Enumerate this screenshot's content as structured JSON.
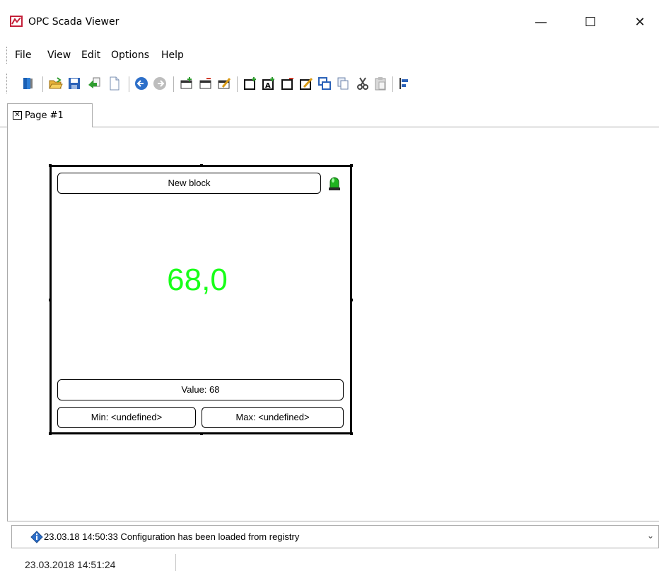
{
  "window": {
    "title": "OPC Scada Viewer",
    "minimize_glyph": "—",
    "maximize_glyph": "☐",
    "close_glyph": "✕"
  },
  "menu": {
    "items": [
      "File",
      "View",
      "Edit",
      "Options",
      "Help"
    ]
  },
  "toolbar": {
    "buttons": [
      "open-door-icon",
      "open-folder-icon",
      "save-icon",
      "import-icon",
      "new-page-icon",
      "back-icon",
      "forward-icon",
      "add-page-icon",
      "remove-page-icon",
      "edit-page-icon",
      "add-block-icon",
      "add-text-block-icon",
      "remove-block-icon",
      "edit-block-icon",
      "bring-front-icon",
      "copy-icon",
      "cut-icon",
      "paste-icon",
      "align-icon"
    ]
  },
  "tabs": [
    {
      "label": "Page #1",
      "close_glyph": "✕"
    }
  ],
  "block": {
    "title": "New block",
    "value": "68,0",
    "value_color": "#19ff19",
    "status_led_color": "#1fb31f",
    "value_line": "Value: 68",
    "min_line": "Min: <undefined>",
    "max_line": "Max: <undefined>"
  },
  "log": {
    "message": "23.03.18 14:50:33 Configuration has been loaded from registry",
    "icon": "info-diamond-icon",
    "chevron": "⌄"
  },
  "status": {
    "datetime": "23.03.2018 14:51:24"
  }
}
